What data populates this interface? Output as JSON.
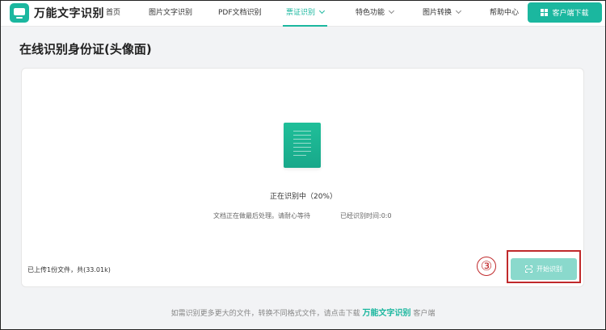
{
  "header": {
    "logo_text": "万能文字识别",
    "nav": [
      {
        "label": "首页"
      },
      {
        "label": "图片文字识别"
      },
      {
        "label": "PDF文档识别"
      },
      {
        "label": "票证识别"
      },
      {
        "label": "特色功能"
      },
      {
        "label": "图片转换"
      },
      {
        "label": "帮助中心"
      }
    ],
    "download_label": "客户端下载"
  },
  "page": {
    "title": "在线识别身份证(头像面)"
  },
  "card": {
    "status": "正在识别中（20%）",
    "progress_percent": 20,
    "processing_note": "文档正在做最后处理。请耐心等待",
    "elapsed": "已经识别时间:0:0",
    "upload_info": "已上传1份文件，共(33.01k)",
    "start_label": "开始识别"
  },
  "annotation": {
    "number": "③"
  },
  "footer": {
    "prefix": "如需识别更多更大的文件，转换不同格式文件，请点击下载",
    "brand": "万能文字识别",
    "suffix": "客户端"
  },
  "colors": {
    "accent": "#1bb79f",
    "button_disabled": "#8ad9cc",
    "annotation": "#c0292b"
  }
}
